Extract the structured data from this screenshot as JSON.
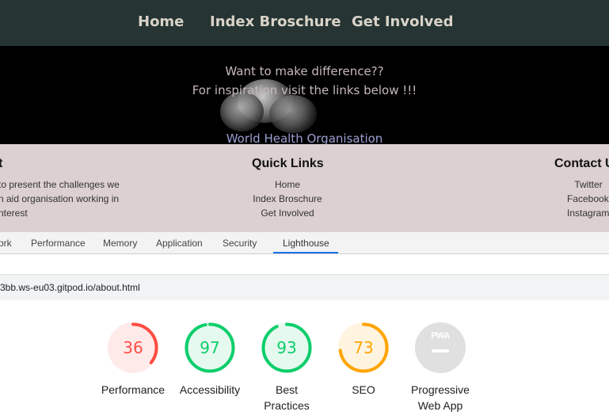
{
  "nav": {
    "items": [
      "Home",
      "Index Broschure",
      "Get Involved"
    ]
  },
  "hero": {
    "line1": "Want to make difference??",
    "line2": "For inspiration visit the links below !!!",
    "link": "World Health Organisation"
  },
  "footer": {
    "about": {
      "title": "t",
      "lines": [
        "to present the challenges we",
        "n aid organisation working in",
        "nterest"
      ]
    },
    "quick_links": {
      "title": "Quick Links",
      "items": [
        "Home",
        "Index Broschure",
        "Get Involved"
      ]
    },
    "contact": {
      "title": "Contact U",
      "items": [
        "Twitter",
        "Facebook",
        "Instagram"
      ]
    }
  },
  "devtools": {
    "tabs": [
      "ork",
      "Performance",
      "Memory",
      "Application",
      "Security",
      "Lighthouse"
    ],
    "active_tab": "Lighthouse",
    "url": "3bb.ws-eu03.gitpod.io/about.html"
  },
  "scores": [
    {
      "label": "Performance",
      "value": "36",
      "fraction": 0.36,
      "color": "#ff4e42",
      "bg": "#ffeaea"
    },
    {
      "label": "Accessibility",
      "value": "97",
      "fraction": 0.97,
      "color": "#0cce6b",
      "bg": "#e6f9ef"
    },
    {
      "label": "Best Practices",
      "value": "93",
      "fraction": 0.93,
      "color": "#0cce6b",
      "bg": "#e6f9ef"
    },
    {
      "label": "SEO",
      "value": "73",
      "fraction": 0.73,
      "color": "#ffa400",
      "bg": "#fff4e0"
    },
    {
      "label": "Progressive Web App",
      "value": "PWA",
      "icon": "pwa-badge-icon"
    }
  ],
  "colors": {
    "nav_bg": "#263533",
    "footer_bg": "#ddd0d0",
    "accent_tab": "#1a73e8"
  }
}
